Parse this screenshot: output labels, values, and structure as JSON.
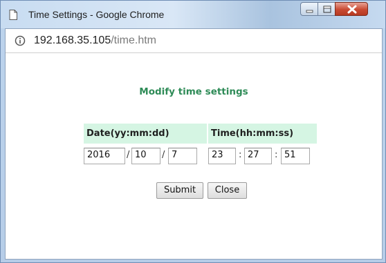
{
  "window": {
    "title": "Time Settings - Google Chrome"
  },
  "address_bar": {
    "host": "192.168.35.105",
    "path": "/time.htm"
  },
  "form": {
    "heading": "Modify time settings",
    "date_header": "Date(yy:mm:dd)",
    "time_header": "Time(hh:mm:ss)",
    "date": {
      "year": "2016",
      "month": "10",
      "day": "7"
    },
    "time": {
      "hour": "23",
      "minute": "27",
      "second": "51"
    },
    "date_separator": "/",
    "time_separator": ":",
    "submit_label": "Submit",
    "close_label": "Close"
  },
  "colors": {
    "heading": "#2e8b57",
    "header_bg": "#d5f5e3"
  }
}
